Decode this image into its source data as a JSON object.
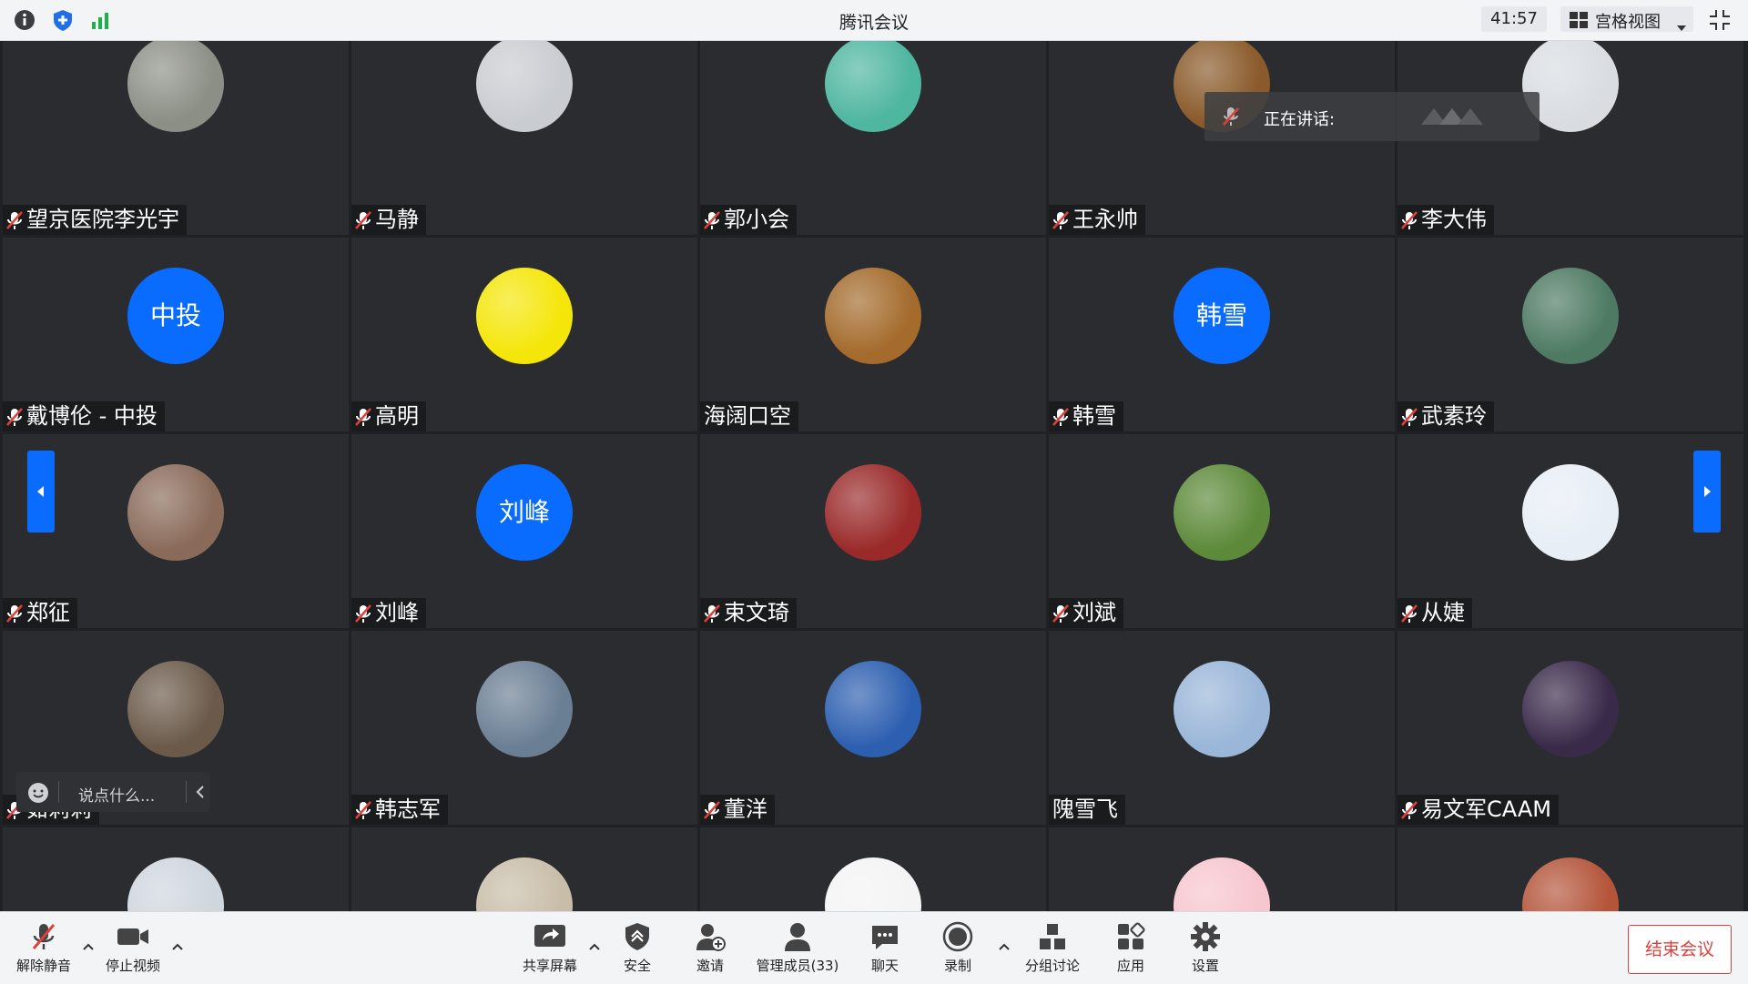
{
  "titlebar": {
    "title": "腾讯会议",
    "timer": "41:57",
    "view_mode": "宫格视图"
  },
  "talking_indicator": {
    "label": "正在讲话:"
  },
  "participants": [
    {
      "name": "望京医院李光宇",
      "avatar": "photo",
      "muted": true,
      "color": "#8c8f86"
    },
    {
      "name": "马静",
      "avatar": "photo",
      "muted": true,
      "color": "#c9ccd1"
    },
    {
      "name": "郭小会",
      "avatar": "photo",
      "muted": true,
      "color": "#4fb6a0"
    },
    {
      "name": "王永帅",
      "avatar": "photo",
      "muted": true,
      "color": "#8a5a2a"
    },
    {
      "name": "李大伟",
      "avatar": "photo",
      "muted": true,
      "color": "#d9dde2"
    },
    {
      "name": "戴博伦 - 中投",
      "avatar": "中投",
      "muted": true
    },
    {
      "name": "高明",
      "avatar": "photo",
      "muted": true,
      "color": "#f5e60a"
    },
    {
      "name": "海阔口空",
      "avatar": "photo",
      "muted": false,
      "color": "#a46b2c"
    },
    {
      "name": "韩雪",
      "avatar": "韩雪",
      "muted": true
    },
    {
      "name": "武素玲",
      "avatar": "photo",
      "muted": true,
      "color": "#4e7a63"
    },
    {
      "name": "郑征",
      "avatar": "photo",
      "muted": true,
      "color": "#8a6b5a"
    },
    {
      "name": "刘峰",
      "avatar": "刘峰",
      "muted": true
    },
    {
      "name": "束文琦",
      "avatar": "photo",
      "muted": true,
      "color": "#9a2a2a"
    },
    {
      "name": "刘斌",
      "avatar": "photo",
      "muted": true,
      "color": "#5d8a3a"
    },
    {
      "name": "从婕",
      "avatar": "photo",
      "muted": true,
      "color": "#e8eef6"
    },
    {
      "name": "茹莉莉",
      "avatar": "photo",
      "muted": true,
      "color": "#6b5a4a"
    },
    {
      "name": "韩志军",
      "avatar": "photo",
      "muted": true,
      "color": "#6b7f94"
    },
    {
      "name": "董洋",
      "avatar": "photo",
      "muted": true,
      "color": "#2d5fb0"
    },
    {
      "name": "隗雪飞",
      "avatar": "photo",
      "muted": false,
      "color": "#9ab6d8"
    },
    {
      "name": "易文军CAAM",
      "avatar": "photo",
      "muted": true,
      "color": "#3a2a4a"
    },
    {
      "name": "",
      "avatar": "photo",
      "muted": true,
      "color": "#cfd6de"
    },
    {
      "name": "",
      "avatar": "photo",
      "muted": true,
      "color": "#c8bda8"
    },
    {
      "name": "",
      "avatar": "photo",
      "muted": true,
      "color": "#f4f4f4"
    },
    {
      "name": "",
      "avatar": "photo",
      "muted": true,
      "color": "#f7c6cf"
    },
    {
      "name": "",
      "avatar": "photo",
      "muted": true,
      "color": "#b4553a"
    }
  ],
  "chat": {
    "placeholder": "说点什么..."
  },
  "toolbar": {
    "unmute": "解除静音",
    "stop_video": "停止视频",
    "share_screen": "共享屏幕",
    "security": "安全",
    "invite": "邀请",
    "manage_members": "管理成员(33)",
    "chat": "聊天",
    "record": "录制",
    "breakout": "分组讨论",
    "apps": "应用",
    "settings": "设置",
    "end_meeting": "结束会议"
  },
  "colors": {
    "accent": "#0a6cff",
    "end_red": "#e0403a",
    "tile_bg": "#2a2c2f"
  }
}
